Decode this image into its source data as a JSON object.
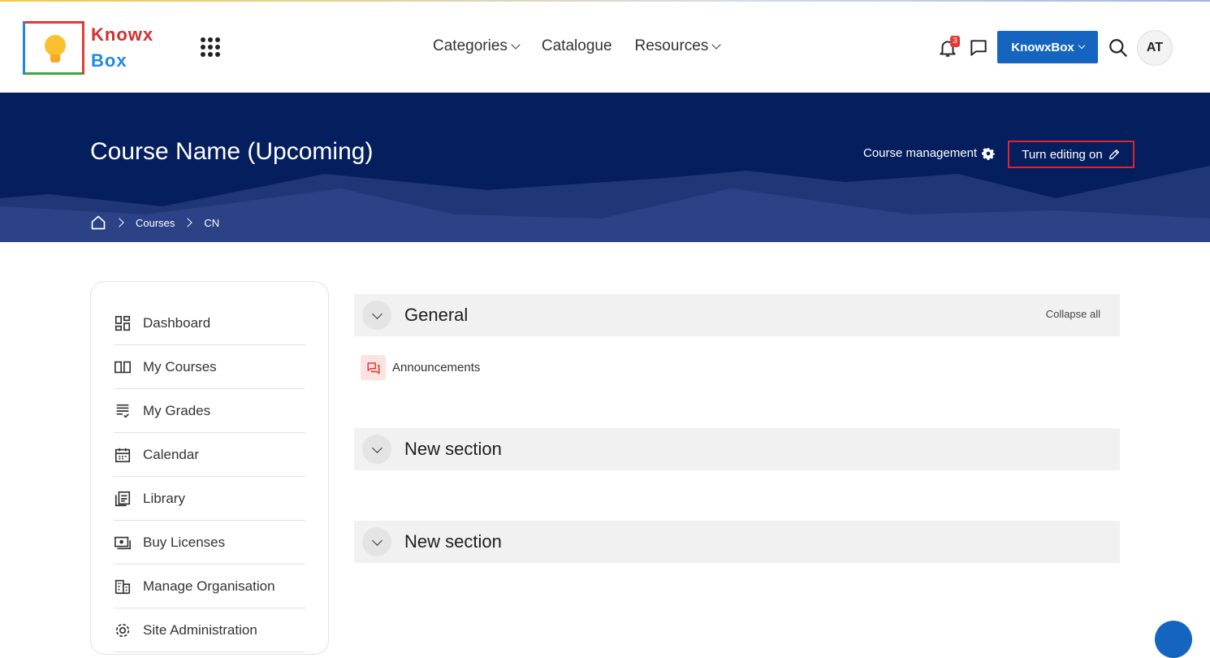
{
  "brand": {
    "line1": "Knowx",
    "line2": "Box"
  },
  "nav": {
    "menu": [
      {
        "label": "Categories",
        "has_dropdown": true
      },
      {
        "label": "Catalogue",
        "has_dropdown": false
      },
      {
        "label": "Resources",
        "has_dropdown": true
      }
    ],
    "notification_count": "3",
    "org_button": "KnowxBox",
    "avatar_initials": "AT"
  },
  "header": {
    "title": "Course Name (Upcoming)",
    "course_management": "Course management",
    "turn_editing": "Turn editing on",
    "breadcrumb": [
      "Courses",
      "CN"
    ]
  },
  "sidebar": {
    "items": [
      {
        "label": "Dashboard",
        "icon": "dashboard-icon"
      },
      {
        "label": "My Courses",
        "icon": "book-icon"
      },
      {
        "label": "My Grades",
        "icon": "grades-icon"
      },
      {
        "label": "Calendar",
        "icon": "calendar-icon"
      },
      {
        "label": "Library",
        "icon": "library-icon"
      },
      {
        "label": "Buy Licenses",
        "icon": "licenses-icon"
      },
      {
        "label": "Manage Organisation",
        "icon": "organisation-icon"
      },
      {
        "label": "Site Administration",
        "icon": "settings-icon"
      }
    ]
  },
  "course": {
    "collapse_all": "Collapse all",
    "sections": [
      {
        "title": "General",
        "activities": [
          {
            "label": "Announcements",
            "icon": "forum-icon"
          }
        ]
      },
      {
        "title": "New section",
        "activities": []
      },
      {
        "title": "New section",
        "activities": []
      }
    ]
  },
  "colors": {
    "hero_bg": "#051e5e",
    "primary": "#1565c0",
    "highlight_border": "#e0242b"
  }
}
